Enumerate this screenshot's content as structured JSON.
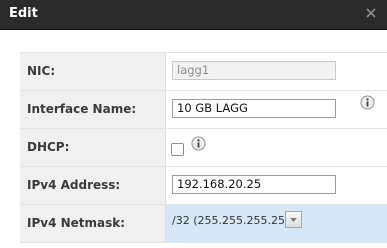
{
  "dialog": {
    "title": "Edit",
    "close_icon": "close-icon"
  },
  "form": {
    "nic": {
      "label": "NIC:",
      "value": "lagg1"
    },
    "interface_name": {
      "label": "Interface Name:",
      "value": "10 GB LAGG"
    },
    "dhcp": {
      "label": "DHCP:",
      "checked": false
    },
    "ipv4_address": {
      "label": "IPv4 Address:",
      "value": "192.168.20.25"
    },
    "ipv4_netmask": {
      "label": "IPv4 Netmask:",
      "value": "/32 (255.255.255.255)"
    }
  },
  "colors": {
    "titlebar": "#2b2b2b",
    "label_bg": "#f0f0f0",
    "highlight": "#d6e7f8"
  }
}
